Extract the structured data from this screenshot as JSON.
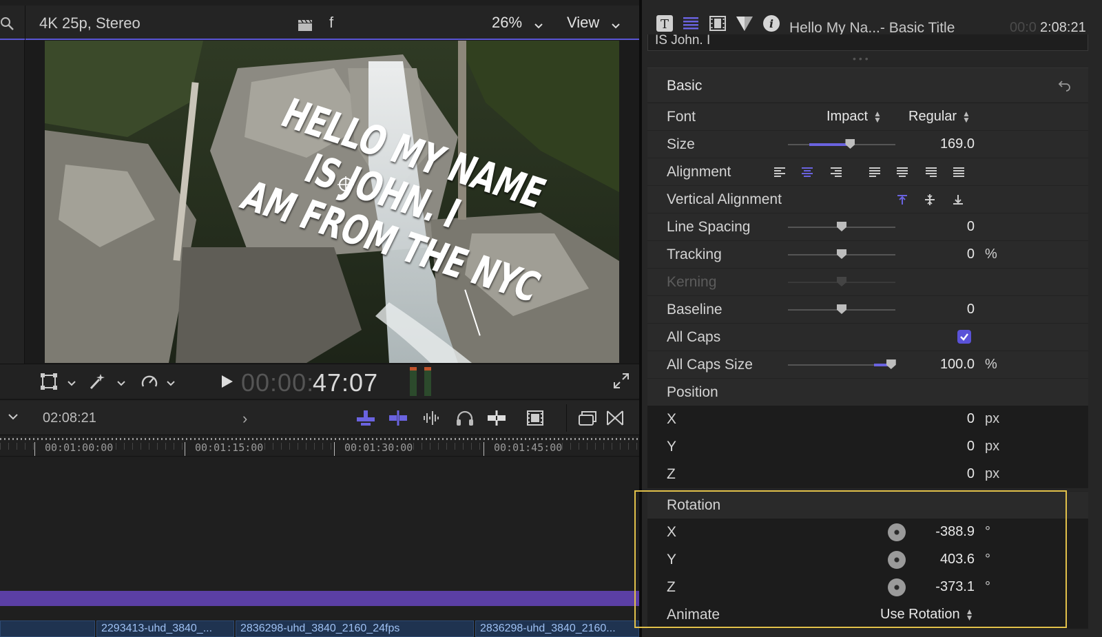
{
  "viewer": {
    "format": "4K 25p, Stereo",
    "f_label": "f",
    "zoom": "26%",
    "view_label": "View",
    "title_lines": [
      "HELLO MY NAME",
      "IS JOHN. I",
      "AM FROM THE NYC"
    ],
    "timecode_dim": "00:00:",
    "timecode_bright": "47:07"
  },
  "timeline": {
    "timecode": "02:08:21",
    "ruler_labels": [
      "00:01:00:00",
      "00:01:15:00",
      "00:01:30:00",
      "00:01:45:00"
    ],
    "clips": [
      "",
      "2293413-uhd_3840_...",
      "2836298-uhd_3840_2160_24fps",
      "2836298-uhd_3840_2160..."
    ]
  },
  "inspector": {
    "title": "Hello My Na...- Basic Title",
    "timecode_dim": "00:0",
    "timecode": "2:08:21",
    "text_preview": "IS John. I",
    "section_title": "Basic",
    "font": {
      "label": "Font",
      "family": "Impact",
      "style": "Regular"
    },
    "size": {
      "label": "Size",
      "value": "169.0",
      "fraction": 0.58
    },
    "alignment": {
      "label": "Alignment"
    },
    "vertical_alignment": {
      "label": "Vertical Alignment"
    },
    "line_spacing": {
      "label": "Line Spacing",
      "value": "0",
      "fraction": 0.5
    },
    "tracking": {
      "label": "Tracking",
      "value": "0",
      "unit": "%",
      "fraction": 0.5
    },
    "kerning": {
      "label": "Kerning"
    },
    "baseline": {
      "label": "Baseline",
      "value": "0",
      "fraction": 0.5
    },
    "all_caps": {
      "label": "All Caps",
      "checked": true
    },
    "all_caps_size": {
      "label": "All Caps Size",
      "value": "100.0",
      "unit": "%",
      "fraction": 1.0
    },
    "position": {
      "label": "Position",
      "x": {
        "label": "X",
        "value": "0",
        "unit": "px"
      },
      "y": {
        "label": "Y",
        "value": "0",
        "unit": "px"
      },
      "z": {
        "label": "Z",
        "value": "0",
        "unit": "px"
      }
    },
    "rotation": {
      "label": "Rotation",
      "x": {
        "label": "X",
        "value": "-388.9",
        "unit": "°"
      },
      "y": {
        "label": "Y",
        "value": "403.6",
        "unit": "°"
      },
      "z": {
        "label": "Z",
        "value": "-373.1",
        "unit": "°"
      },
      "animate": {
        "label": "Animate",
        "value": "Use Rotation"
      }
    }
  },
  "colors": {
    "accent": "#5a56d6",
    "highlight_box": "#e2c14a",
    "timeline_track": "#5b3fa5"
  }
}
